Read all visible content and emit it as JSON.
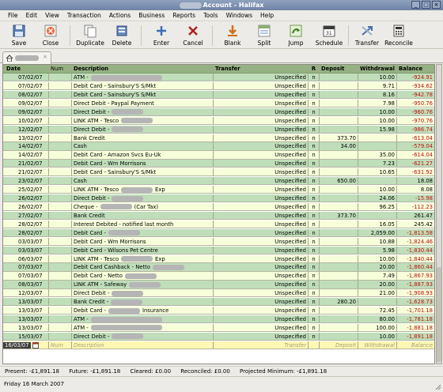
{
  "window": {
    "title": "Account - Halifax"
  },
  "menu": [
    "File",
    "Edit",
    "View",
    "Transaction",
    "Actions",
    "Business",
    "Reports",
    "Tools",
    "Windows",
    "Help"
  ],
  "toolbar": [
    {
      "label": "Save",
      "icon": "save-icon"
    },
    {
      "label": "Close",
      "icon": "close-icon"
    },
    {
      "label": "Duplicate",
      "icon": "duplicate-icon"
    },
    {
      "label": "Delete",
      "icon": "delete-icon"
    },
    {
      "label": "Enter",
      "icon": "enter-icon"
    },
    {
      "label": "Cancel",
      "icon": "cancel-icon"
    },
    {
      "label": "Blank",
      "icon": "blank-icon"
    },
    {
      "label": "Split",
      "icon": "split-icon"
    },
    {
      "label": "Jump",
      "icon": "jump-icon"
    },
    {
      "label": "Schedule",
      "icon": "schedule-icon"
    },
    {
      "label": "Transfer",
      "icon": "transfer-icon"
    },
    {
      "label": "Reconcile",
      "icon": "reconcile-icon"
    }
  ],
  "tab": {
    "close": "×"
  },
  "columns": {
    "date": "Date",
    "num": "Num",
    "description": "Description",
    "transfer": "Transfer",
    "r": "R",
    "deposit": "Deposit",
    "withdrawal": "Withdrawal",
    "balance": "Balance"
  },
  "rows": [
    {
      "date": "07/02/07",
      "desc": "ATM -",
      "redact": 2,
      "transfer": "Unspecified",
      "r": "n",
      "deposit": "",
      "withdrawal": "10.00",
      "balance": "-924.91",
      "neg": true
    },
    {
      "date": "07/02/07",
      "desc": "Debit Card - Sainsbury'S S/Mkt",
      "transfer": "Unspecified",
      "r": "n",
      "deposit": "",
      "withdrawal": "9.71",
      "balance": "-934.62",
      "neg": true
    },
    {
      "date": "08/02/07",
      "desc": "Debit Card - Sainsbury'S S/Mkt",
      "transfer": "Unspecified",
      "r": "n",
      "deposit": "",
      "withdrawal": "8.16",
      "balance": "-942.78",
      "neg": true
    },
    {
      "date": "09/02/07",
      "desc": "Direct Debit - Paypal Payment",
      "transfer": "Unspecified",
      "r": "n",
      "deposit": "",
      "withdrawal": "7.98",
      "balance": "-950.76",
      "neg": true
    },
    {
      "date": "09/02/07",
      "desc": "Direct Debit -",
      "redact": 1,
      "transfer": "Unspecified",
      "r": "n",
      "deposit": "",
      "withdrawal": "10.00",
      "balance": "-960.76",
      "neg": true
    },
    {
      "date": "10/02/07",
      "desc": "LINK ATM - Tesco",
      "redact": 1,
      "transfer": "Unspecified",
      "r": "n",
      "deposit": "",
      "withdrawal": "10.00",
      "balance": "-970.76",
      "neg": true
    },
    {
      "date": "12/02/07",
      "desc": "Direct Debit -",
      "redact": 1,
      "transfer": "Unspecified",
      "r": "n",
      "deposit": "",
      "withdrawal": "15.98",
      "balance": "-986.74",
      "neg": true
    },
    {
      "date": "13/02/07",
      "desc": "Bank Credit",
      "transfer": "Unspecified",
      "r": "n",
      "deposit": "373.70",
      "withdrawal": "",
      "balance": "-613.04",
      "neg": true
    },
    {
      "date": "14/02/07",
      "desc": "Cash",
      "transfer": "Unspecified",
      "r": "n",
      "deposit": "34.00",
      "withdrawal": "",
      "balance": "-579.04",
      "neg": true
    },
    {
      "date": "14/02/07",
      "desc": "Debit Card - Amazon Svcs Eu-Uk",
      "transfer": "Unspecified",
      "r": "n",
      "deposit": "",
      "withdrawal": "35.00",
      "balance": "-614.04",
      "neg": true
    },
    {
      "date": "21/02/07",
      "desc": "Debit Card - Wm Morrisons",
      "transfer": "Unspecified",
      "r": "n",
      "deposit": "",
      "withdrawal": "7.23",
      "balance": "-621.27",
      "neg": true
    },
    {
      "date": "21/02/07",
      "desc": "Debit Card - Sainsbury'S S/Mkt",
      "transfer": "Unspecified",
      "r": "n",
      "deposit": "",
      "withdrawal": "10.65",
      "balance": "-631.92",
      "neg": true
    },
    {
      "date": "23/02/07",
      "desc": "Cash",
      "transfer": "Unspecified",
      "r": "n",
      "deposit": "650.00",
      "withdrawal": "",
      "balance": "18.08",
      "neg": false
    },
    {
      "date": "25/02/07",
      "desc": "LINK ATM - Tesco",
      "redact": 1,
      "suffix": "Exp",
      "transfer": "Unspecified",
      "r": "n",
      "deposit": "",
      "withdrawal": "10.00",
      "balance": "8.08",
      "neg": false
    },
    {
      "date": "26/02/07",
      "desc": "Direct Debit -",
      "redact": 1,
      "transfer": "Unspecified",
      "r": "n",
      "deposit": "",
      "withdrawal": "24.06",
      "balance": "-15.98",
      "neg": true
    },
    {
      "date": "26/02/07",
      "desc": "Cheque -",
      "redact": 1,
      "suffix": "(Car Tax)",
      "transfer": "Unspecified",
      "r": "n",
      "deposit": "",
      "withdrawal": "96.25",
      "balance": "-112.23",
      "neg": true
    },
    {
      "date": "27/02/07",
      "desc": "Bank Credit",
      "transfer": "Unspecified",
      "r": "n",
      "deposit": "373.70",
      "withdrawal": "",
      "balance": "261.47",
      "neg": false
    },
    {
      "date": "28/02/07",
      "desc": "Interest Debited - notified last month",
      "transfer": "Unspecified",
      "r": "n",
      "deposit": "",
      "withdrawal": "16.05",
      "balance": "245.42",
      "neg": false
    },
    {
      "date": "28/02/07",
      "desc": "Debit Card -",
      "redact": 1,
      "transfer": "Unspecified",
      "r": "n",
      "deposit": "",
      "withdrawal": "2,059.00",
      "balance": "-1,813.58",
      "neg": true
    },
    {
      "date": "03/03/07",
      "desc": "Debit Card - Wm Morrisons",
      "transfer": "Unspecified",
      "r": "n",
      "deposit": "",
      "withdrawal": "10.88",
      "balance": "-1,824.46",
      "neg": true
    },
    {
      "date": "03/03/07",
      "desc": "Debit Card - Wilsons Pet Centre",
      "transfer": "Unspecified",
      "r": "n",
      "deposit": "",
      "withdrawal": "5.98",
      "balance": "-1,830.44",
      "neg": true
    },
    {
      "date": "06/03/07",
      "desc": "LINK ATM - Tesco",
      "redact": 1,
      "suffix": "Exp",
      "transfer": "Unspecified",
      "r": "n",
      "deposit": "",
      "withdrawal": "10.00",
      "balance": "-1,840.44",
      "neg": true
    },
    {
      "date": "07/03/07",
      "desc": "Debit Card Cashback - Netto",
      "redact": 1,
      "transfer": "Unspecified",
      "r": "n",
      "deposit": "",
      "withdrawal": "20.00",
      "balance": "-1,860.44",
      "neg": true
    },
    {
      "date": "07/03/07",
      "desc": "Debit Card - Netto",
      "redact": 1,
      "transfer": "Unspecified",
      "r": "n",
      "deposit": "",
      "withdrawal": "7.49",
      "balance": "-1,867.93",
      "neg": true
    },
    {
      "date": "08/03/07",
      "desc": "LINK ATM - Safeway",
      "redact": 1,
      "transfer": "Unspecified",
      "r": "n",
      "deposit": "",
      "withdrawal": "20.00",
      "balance": "-1,887.93",
      "neg": true
    },
    {
      "date": "12/03/07",
      "desc": "Direct Debit -",
      "redact": 1,
      "transfer": "Unspecified",
      "r": "n",
      "deposit": "",
      "withdrawal": "21.00",
      "balance": "-1,908.93",
      "neg": true
    },
    {
      "date": "13/03/07",
      "desc": "Bank Credit -",
      "redact": 1,
      "transfer": "Unspecified",
      "r": "n",
      "deposit": "280.20",
      "withdrawal": "",
      "balance": "-1,628.73",
      "neg": true
    },
    {
      "date": "13/03/07",
      "desc": "Debit Card -",
      "redact": 1,
      "suffix": "Insurance",
      "transfer": "Unspecified",
      "r": "n",
      "deposit": "",
      "withdrawal": "72.45",
      "balance": "-1,701.18",
      "neg": true
    },
    {
      "date": "13/03/07",
      "desc": "ATM -",
      "redact": 2,
      "transfer": "Unspecified",
      "r": "n",
      "deposit": "",
      "withdrawal": "80.00",
      "balance": "-1,781.18",
      "neg": true
    },
    {
      "date": "13/03/07",
      "desc": "ATM -",
      "redact": 2,
      "transfer": "Unspecified",
      "r": "n",
      "deposit": "",
      "withdrawal": "100.00",
      "balance": "-1,881.18",
      "neg": true
    },
    {
      "date": "15/03/07",
      "desc": "Direct Debit -",
      "redact": 1,
      "transfer": "Unspecified",
      "r": "n",
      "deposit": "",
      "withdrawal": "10.00",
      "balance": "-1,891.18",
      "neg": true
    }
  ],
  "blank_row": {
    "date": "16/03/07",
    "num": "Num",
    "desc": "Description",
    "transfer": "Transfer",
    "deposit": "Deposit",
    "withdrawal": "Withdrawal",
    "balance": "Balance"
  },
  "summary": {
    "present": "Present: -£1,891.18",
    "future": "Future: -£1,891.18",
    "cleared": "Cleared: £0.00",
    "reconciled": "Reconciled: £0.00",
    "projected": "Projected Minimum: -£1,891.18"
  },
  "status": "Friday 16 March 2007",
  "colors": {
    "negative": "#c01010",
    "row_green": "#bfdeb9",
    "row_cream": "#f6ffda",
    "header": "#96b183",
    "blank_row": "#fff7b3"
  }
}
